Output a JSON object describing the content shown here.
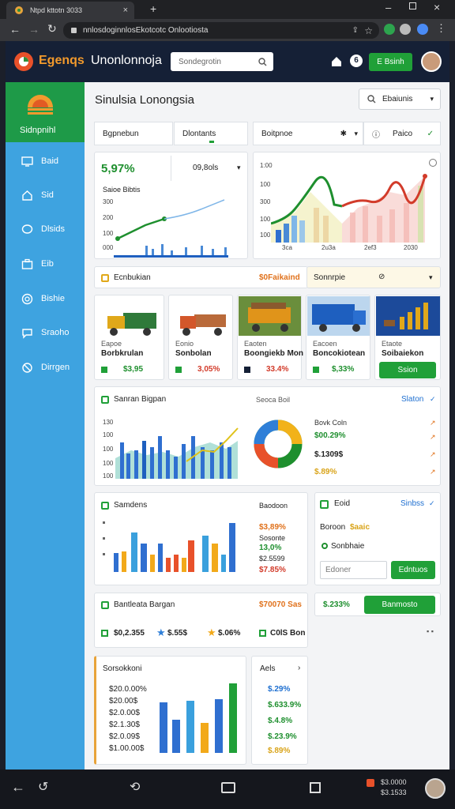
{
  "browser": {
    "tab_title": "Ntpd kttotn 3033",
    "url": "nnlosdoginnlosEkotcotc Onlootiosta"
  },
  "app": {
    "brand": "Egenqs",
    "title": "Unonlonnoja",
    "search_placeholder": "Sondegrotin",
    "header_button": "E Bsinh"
  },
  "sidebar": {
    "brand_label": "Sidnpnihl",
    "items": [
      {
        "label": "Baid",
        "icon": "monitor-icon"
      },
      {
        "label": "Sid",
        "icon": "house-icon"
      },
      {
        "label": "Dlsids",
        "icon": "chat-icon"
      },
      {
        "label": "Eib",
        "icon": "briefcase-icon"
      },
      {
        "label": "Bishie",
        "icon": "globe-icon"
      },
      {
        "label": "Sraoho",
        "icon": "chat-bubble-icon"
      },
      {
        "label": "Dirrgen",
        "icon": "gear-icon"
      }
    ]
  },
  "page": {
    "title": "Sinulsia Lonongsia",
    "filter_label": "Ebaiunis"
  },
  "filters": {
    "f1": "Bgpnebun",
    "f2": "Dlontants",
    "f3": "Boitpnoe",
    "f4": "Paico"
  },
  "kpi": {
    "value": "5,97%",
    "secondary": "09,8ols",
    "chart_title": "Saioe Bibtis",
    "y_ticks": [
      "300",
      "200",
      "100",
      "000"
    ]
  },
  "trend_chart": {
    "y_ticks": [
      "1:00",
      "100",
      "300",
      "100",
      "100"
    ],
    "x_ticks": [
      "3ca",
      "2u3a",
      "2ef3",
      "2030"
    ]
  },
  "products": {
    "header": "Ecnbukian",
    "header_value": "$0Faikaind",
    "dropdown": "Sonnrpie",
    "items": [
      {
        "name": "Borbkrulan",
        "value": "$3,95",
        "status": "Eapoe"
      },
      {
        "name": "Sonbolan",
        "value": "3,05%",
        "status": "Eonio"
      },
      {
        "name": "Boongiekb Mon",
        "value": "33.4%",
        "status": "Eaoten"
      },
      {
        "name": "Boncokiotean",
        "value": "$,33%",
        "status": "Eacoen"
      },
      {
        "name": "Soibaiekon",
        "value": "",
        "status": "Etaote"
      }
    ],
    "buy_label": "Ssion"
  },
  "sales": {
    "title": "Sanran Bigpan",
    "subtitle": "Seoca Boil",
    "link": "Slaton",
    "y_ticks": [
      "130",
      "100",
      "100",
      "100",
      "100"
    ],
    "legend_title": "Bovk Coln",
    "stats": [
      "$00.29%",
      "$.1309$",
      "$.89%"
    ]
  },
  "bars": {
    "title": "Samdens",
    "subtitle": "Baodoon",
    "stats": [
      "$3,89%",
      "Sosonte",
      "13,0%",
      "$2.5599",
      "$7.85%"
    ]
  },
  "side_panel": {
    "title": "Eoid",
    "link": "Sinbss",
    "line1": "Boroon",
    "line1_value": "$aaic",
    "line2": "Sonbhaie",
    "input_placeholder": "Edoner",
    "button": "Edntuos"
  },
  "summary": {
    "title": "Bantleata Bargan",
    "value": "$70070 Sas",
    "items": [
      "$0,2.355",
      "$.55$",
      "$.06%",
      "C0lS Bon"
    ],
    "cta_value": "$.233%",
    "cta_button": "Banmosto"
  },
  "list": {
    "title": "Sorsokkoni",
    "values": [
      "$20.0.00%",
      "$20.00$",
      "$2.0.00$",
      "$2.1.30$",
      "$2.0.09$",
      "$1.00.00$"
    ]
  },
  "alerts": {
    "title": "Aels",
    "values": [
      "$.29%",
      "$.633.9%",
      "$.4.8%",
      "$.23.9%",
      "$.89%"
    ]
  },
  "taskbar": {
    "tray_1": "$3.0000",
    "tray_2": "$3.1533"
  },
  "colors": {
    "sidebar": "#3ea3e0",
    "sidebar_brand": "#1e9a48",
    "accent_green": "#20a038",
    "header": "#152036"
  }
}
